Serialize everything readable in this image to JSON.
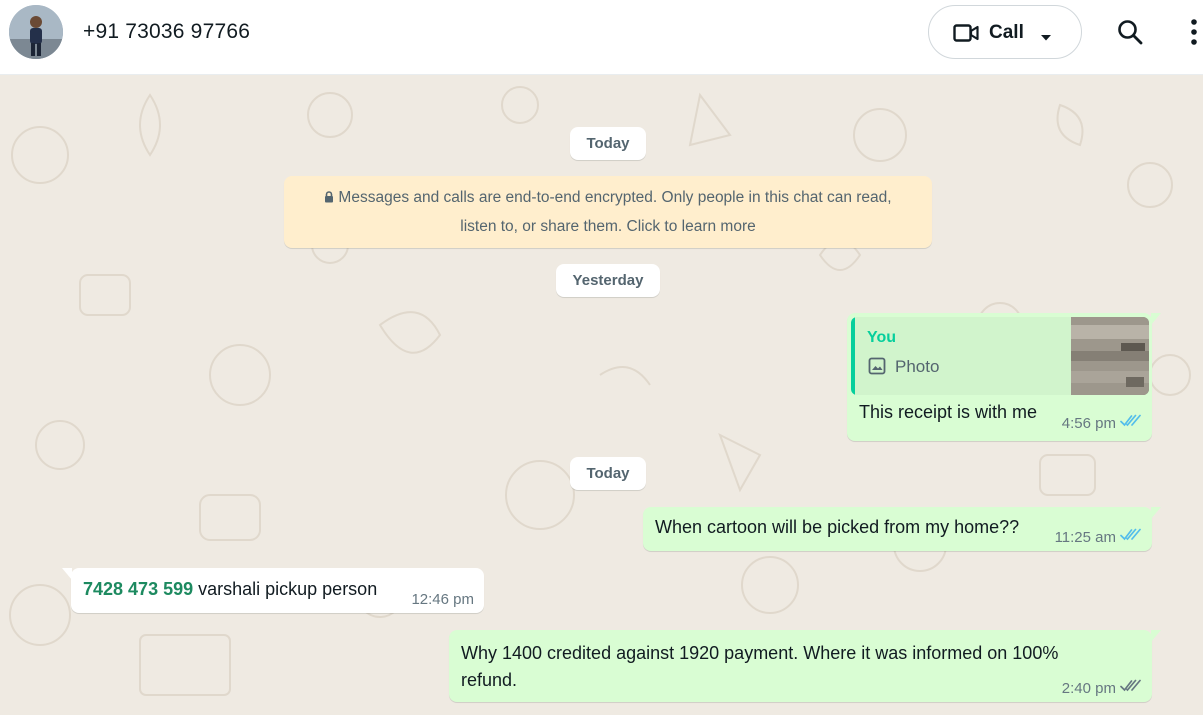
{
  "header": {
    "contact_name": "+91 73036 97766",
    "call_label": "Call"
  },
  "chat": {
    "date_chips": [
      "Today",
      "Yesterday",
      "Today"
    ],
    "encryption_notice": {
      "line1": "Messages and calls are end-to-end encrypted. Only people in this chat can read,",
      "line2": "listen to, or share them. Click to learn more"
    },
    "messages": [
      {
        "direction": "out",
        "quote_author": "You",
        "quote_label": "Photo",
        "text": "This receipt is with me",
        "time": "4:56 pm",
        "status": "read"
      },
      {
        "direction": "out",
        "text": "When cartoon will be picked from my home??",
        "time": "11:25 am",
        "status": "read"
      },
      {
        "direction": "in",
        "phone": "7428 473 599",
        "text": " varshali pickup person",
        "time": "12:46 pm"
      },
      {
        "direction": "out",
        "text_line1": "Why 1400 credited against 1920 payment. Where it was informed on 100%",
        "text_line2": "refund.",
        "time": "2:40 pm",
        "status": "delivered"
      }
    ]
  },
  "colors": {
    "outgoing_bubble": "#d9fdd3",
    "incoming_bubble": "#ffffff",
    "read_tick": "#53bdeb",
    "delivered_tick": "#667781",
    "accent_green": "#06cf9c",
    "link_green": "#1d8a60",
    "chat_background": "#efeae2"
  },
  "icons": [
    "video-camera-icon",
    "chevron-down-icon",
    "search-icon",
    "more-options-icon",
    "lock-icon",
    "photo-icon",
    "double-check-icon"
  ]
}
